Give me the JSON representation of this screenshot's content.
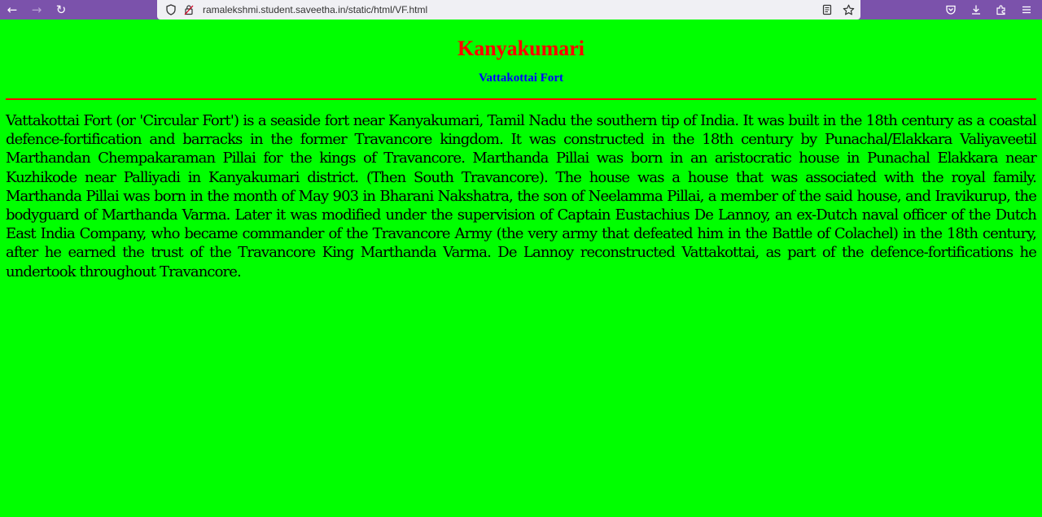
{
  "browser": {
    "url": "ramalekshmi.student.saveetha.in/static/html/VF.html",
    "icons": {
      "back": "arrow-left-icon",
      "forward": "arrow-right-icon",
      "reload": "reload-icon",
      "shield": "shield-icon",
      "lock": "insecure-lock-icon",
      "reader": "reader-view-icon",
      "bookmark": "star-icon",
      "pocket": "pocket-icon",
      "downloads": "download-icon",
      "extensions": "extensions-icon",
      "menu": "hamburger-menu-icon"
    }
  },
  "page": {
    "title": "Kanyakumari",
    "subtitle": "Vattakottai Fort",
    "body": "Vattakottai Fort (or 'Circular Fort') is a seaside fort near Kanyakumari, Tamil Nadu the southern tip of India. It was built in the 18th century as a coastal defence-fortification and barracks in the former Travancore kingdom. It was constructed in the 18th century by Punachal/Elakkara Valiyaveetil Marthandan Chempakaraman Pillai for the kings of Travancore. Marthanda Pillai was born in an aristocratic house in Punachal Elakkara near Kuzhikode near Palliyadi in Kanyakumari district. (Then South Travancore). The house was a house that was associated with the royal family. Marthanda Pillai was born in the month of May 903 in Bharani Nakshatra, the son of Neelamma Pillai, a member of the said house, and Iravikurup, the bodyguard of Marthanda Varma. Later it was modified under the supervision of Captain Eustachius De Lannoy, an ex-Dutch naval officer of the Dutch East India Company, who became commander of the Travancore Army (the very army that defeated him in the Battle of Colachel) in the 18th century, after he earned the trust of the Travancore King Marthanda Varma. De Lannoy reconstructed Vattakottai, as part of the defence-fortifications he undertook throughout Travancore."
  },
  "colors": {
    "background": "#00ff00",
    "title": "#ff0000",
    "subtitle": "#0000ff",
    "divider": "#ff0000",
    "toolbar": "#7b52ab"
  }
}
